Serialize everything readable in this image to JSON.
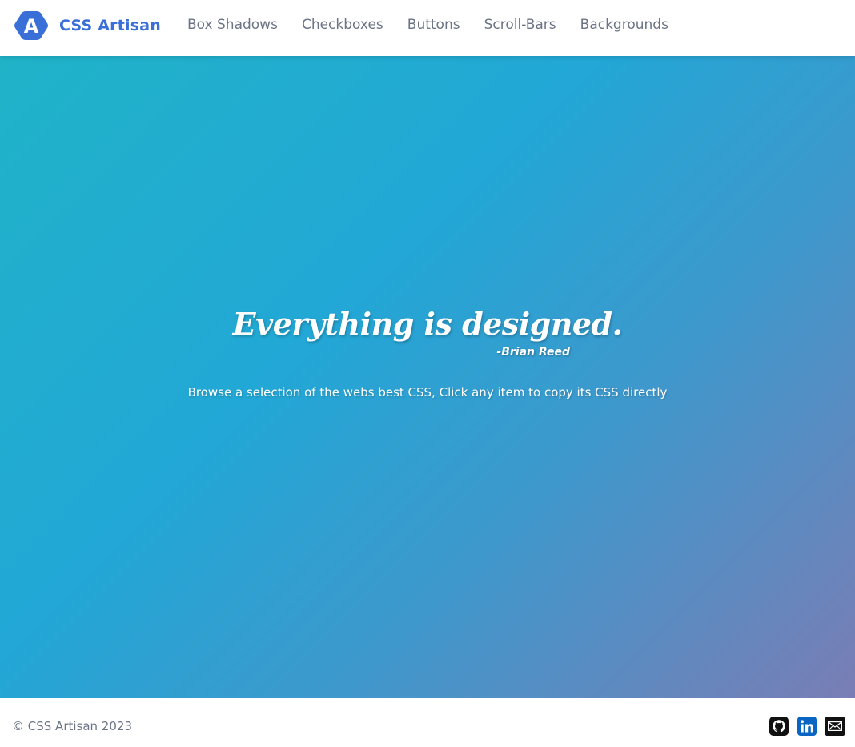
{
  "brand": {
    "name": "CSS Artisan",
    "logo_letter": "A",
    "color": "#3b6fd8"
  },
  "nav": {
    "items": [
      {
        "label": "Box Shadows"
      },
      {
        "label": "Checkboxes"
      },
      {
        "label": "Buttons"
      },
      {
        "label": "Scroll-Bars"
      },
      {
        "label": "Backgrounds"
      }
    ]
  },
  "hero": {
    "quote": "Everything is designed.",
    "author": "-Brian Reed",
    "subtitle": "Browse a selection of the webs best CSS, Click any item to copy its CSS directly",
    "gradient_colors": [
      "#20b3c8",
      "#22a7d6",
      "#3e98cc",
      "#7a7db5"
    ]
  },
  "footer": {
    "copyright": "© CSS Artisan 2023",
    "socials": [
      {
        "icon": "github-icon"
      },
      {
        "icon": "linkedin-icon"
      },
      {
        "icon": "mail-icon"
      }
    ],
    "linkedin_color": "#0a66c2"
  }
}
